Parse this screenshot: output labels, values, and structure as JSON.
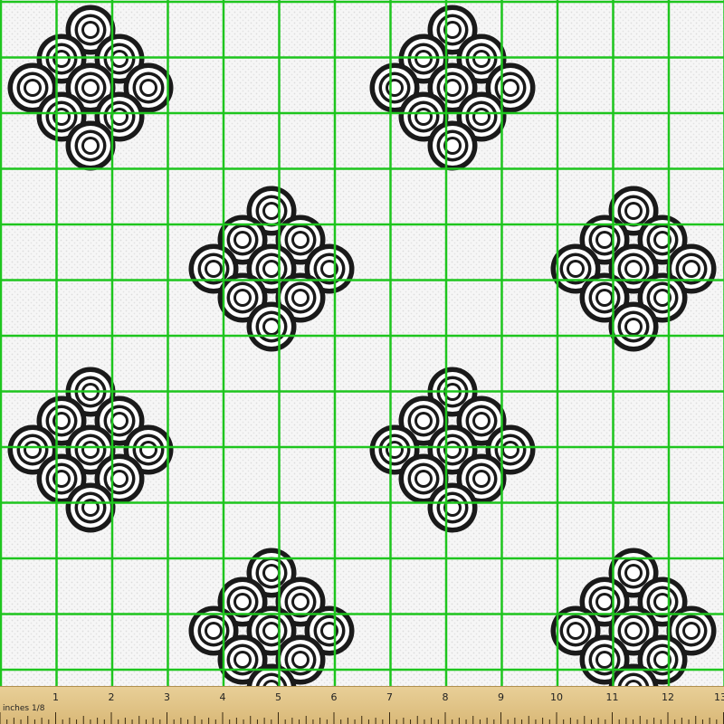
{
  "ruler": {
    "units_label": "inches 1/8",
    "numbers": [
      "1",
      "2",
      "3",
      "4",
      "5",
      "6",
      "7",
      "8",
      "9",
      "10",
      "11",
      "12",
      "13"
    ]
  },
  "colors": {
    "fabric_background": "#f6f6f6",
    "motif": "#1a1a1a",
    "grid": "#1ec51e",
    "ruler": "#dcbc7c"
  },
  "pattern": {
    "motif": "concentric-circle-diamond",
    "circles_per_motif": 9
  }
}
